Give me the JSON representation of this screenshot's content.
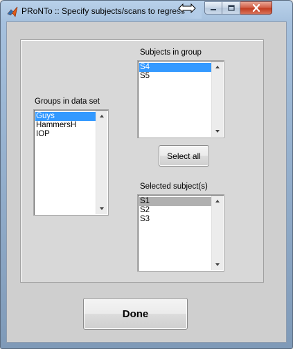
{
  "window": {
    "title": "PRoNTo :: Specify subjects/scans to regress",
    "icon": "matlab-icon",
    "controls": {
      "minimize": "minimize-icon",
      "maximize": "maximize-icon",
      "close": "close-icon"
    }
  },
  "groups": {
    "label": "Groups in data set",
    "items": [
      "Guys",
      "HammersH",
      "IOP"
    ],
    "selected": "Guys"
  },
  "subjects": {
    "label": "Subjects in group",
    "items": [
      "S4",
      "S5"
    ],
    "selected": "S4"
  },
  "select_all_label": "Select all",
  "selected_subjects": {
    "label": "Selected subject(s)",
    "items": [
      "S1",
      "S2",
      "S3"
    ],
    "selected": "S1"
  },
  "done_label": "Done",
  "colors": {
    "selection_active": "#3399ff",
    "selection_inactive": "#b0b0b0",
    "figure_background": "#cfcfcf"
  }
}
